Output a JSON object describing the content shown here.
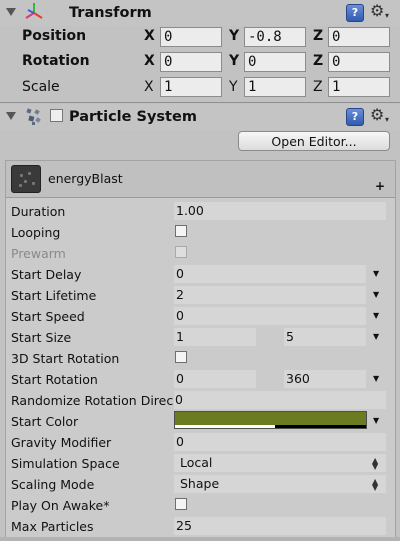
{
  "colors": {
    "start_color": "#6b7b22",
    "help_icon": "#2f5bb0"
  },
  "transform": {
    "title": "Transform",
    "rows": [
      {
        "label": "Position",
        "x": "0",
        "y": "-0.8",
        "z": "0"
      },
      {
        "label": "Rotation",
        "x": "0",
        "y": "0",
        "z": "0"
      },
      {
        "label": "Scale",
        "x": "1",
        "y": "1",
        "z": "1"
      }
    ],
    "axes": {
      "x": "X",
      "y": "Y",
      "z": "Z"
    }
  },
  "particle_system": {
    "title": "Particle System",
    "open_editor_label": "Open Editor...",
    "module_name": "energyBlast",
    "plus": "+",
    "help": "?",
    "props": {
      "duration": {
        "label": "Duration",
        "value": "1.00"
      },
      "looping": {
        "label": "Looping"
      },
      "prewarm": {
        "label": "Prewarm"
      },
      "start_delay": {
        "label": "Start Delay",
        "value": "0"
      },
      "start_lifetime": {
        "label": "Start Lifetime",
        "value": "2"
      },
      "start_speed": {
        "label": "Start Speed",
        "value": "0"
      },
      "start_size": {
        "label": "Start Size",
        "min": "1",
        "max": "5"
      },
      "start_rotation_3d": {
        "label": "3D Start Rotation"
      },
      "start_rotation": {
        "label": "Start Rotation",
        "min": "0",
        "max": "360"
      },
      "randomize_rotation": {
        "label": "Randomize Rotation Direc",
        "value": "0"
      },
      "start_color": {
        "label": "Start Color"
      },
      "gravity_modifier": {
        "label": "Gravity Modifier",
        "value": "0"
      },
      "simulation_space": {
        "label": "Simulation Space",
        "value": "Local"
      },
      "scaling_mode": {
        "label": "Scaling Mode",
        "value": "Shape"
      },
      "play_on_awake": {
        "label": "Play On Awake*"
      },
      "max_particles": {
        "label": "Max Particles",
        "value": "25"
      }
    }
  }
}
